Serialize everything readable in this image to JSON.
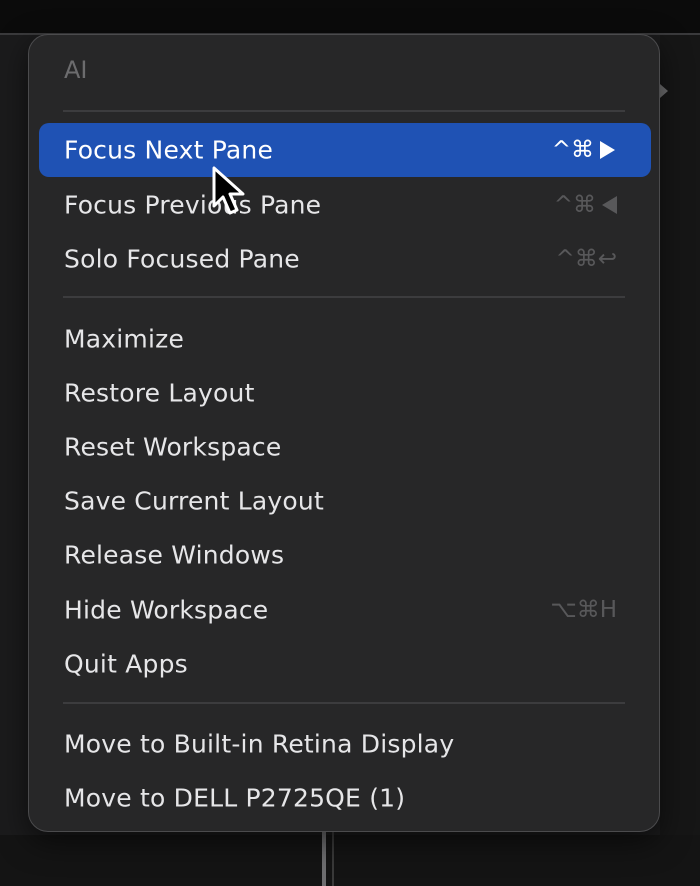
{
  "menu": {
    "section_title": "AI",
    "groups": [
      {
        "items": [
          {
            "label": "Focus Next Pane",
            "shortcut": "^⌘",
            "shortcut_icon": "triangle-right-icon",
            "selected": true
          },
          {
            "label": "Focus Previous Pane",
            "shortcut": "^⌘",
            "shortcut_icon": "triangle-left-icon",
            "selected": false
          },
          {
            "label": "Solo Focused Pane",
            "shortcut": "^⌘↩",
            "shortcut_icon": "return-icon",
            "selected": false
          }
        ]
      },
      {
        "items": [
          {
            "label": "Maximize",
            "shortcut": ""
          },
          {
            "label": "Restore Layout",
            "shortcut": ""
          },
          {
            "label": "Reset Workspace",
            "shortcut": ""
          },
          {
            "label": "Save Current Layout",
            "shortcut": ""
          },
          {
            "label": "Release Windows",
            "shortcut": ""
          },
          {
            "label": "Hide Workspace",
            "shortcut": "⌥⌘H"
          },
          {
            "label": "Quit Apps",
            "shortcut": ""
          }
        ]
      },
      {
        "items": [
          {
            "label": "Move to Built-in Retina Display",
            "shortcut": ""
          },
          {
            "label": "Move to DELL P2725QE (1)",
            "shortcut": ""
          }
        ]
      }
    ]
  },
  "colors": {
    "selection": "#1f52b4",
    "menu_background": "#272728",
    "text": "#e6e6e8",
    "shortcut_text": "#58585a"
  },
  "pointer_icon": "mouse-pointer-icon"
}
